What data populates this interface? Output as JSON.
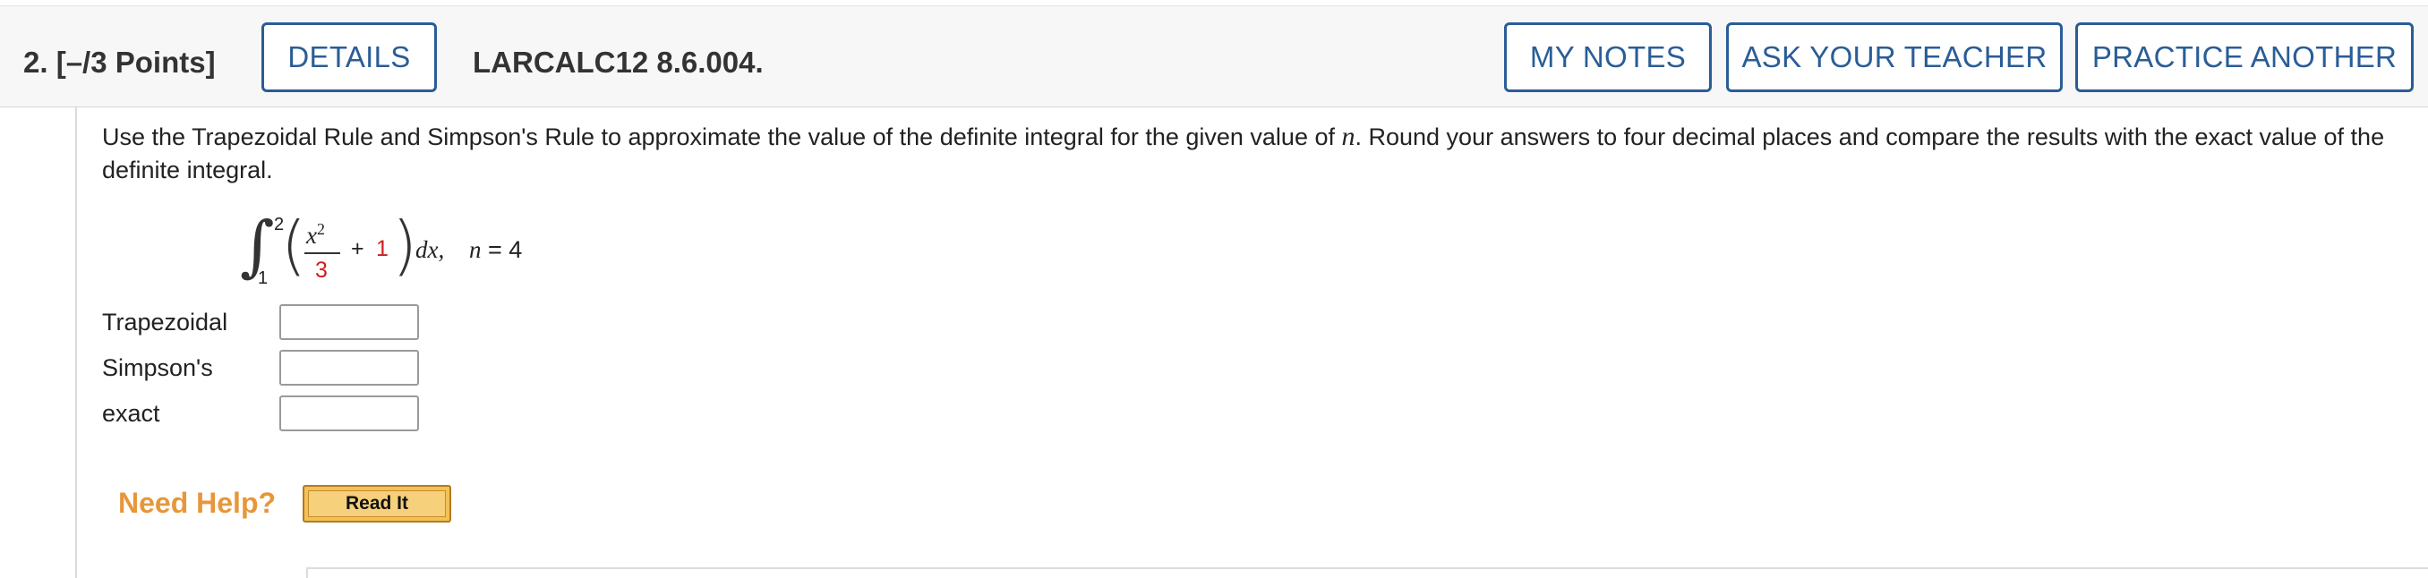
{
  "header": {
    "question_number": "2.",
    "points": "[–/3 Points]",
    "details_label": "DETAILS",
    "problem_code": "LARCALC12 8.6.004.",
    "my_notes_label": "MY NOTES",
    "ask_teacher_label": "ASK YOUR TEACHER",
    "practice_another_label": "PRACTICE ANOTHER"
  },
  "prompt": {
    "part1": "Use the Trapezoidal Rule and Simpson's Rule to approximate the value of the definite integral for the given value of ",
    "var_n": "n",
    "part2": ". Round your answers to four decimal places and compare the results with the exact value of the definite integral."
  },
  "math": {
    "upper_limit": "2",
    "lower_limit": "1",
    "numerator": "x",
    "exponent": "2",
    "denominator": "3",
    "plus": "+",
    "constant": "1",
    "dx": "dx,",
    "n_var": "n",
    "n_eq": " = 4"
  },
  "answers": [
    {
      "label": "Trapezoidal",
      "value": ""
    },
    {
      "label": "Simpson's",
      "value": ""
    },
    {
      "label": "exact",
      "value": ""
    }
  ],
  "help": {
    "need_help_label": "Need Help?",
    "read_it_label": "Read It"
  },
  "colors": {
    "accent_blue": "#2a5d97",
    "red_number": "#cc1f1f",
    "need_help_orange": "#e8963a",
    "read_it_bg": "#f1c257"
  }
}
